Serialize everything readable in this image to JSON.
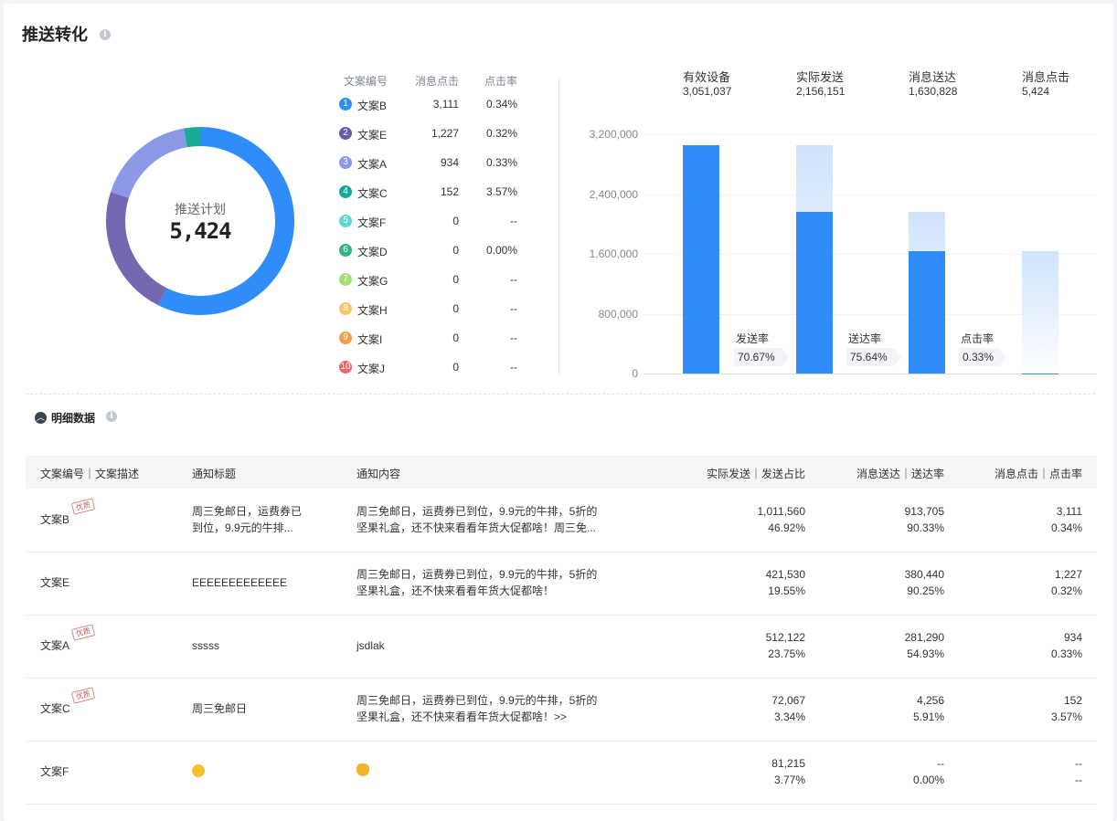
{
  "header": {
    "title": "推送转化",
    "info_icon": "info-icon"
  },
  "donut": {
    "center_label": "推送计划",
    "center_value": "5,424",
    "segments": [
      {
        "name": "文案B",
        "value": 3111,
        "color": "#2f8cf8"
      },
      {
        "name": "文案E",
        "value": 1227,
        "color": "#7568b3"
      },
      {
        "name": "文案A",
        "value": 934,
        "color": "#8a98e6"
      },
      {
        "name": "文案C",
        "value": 152,
        "color": "#1aaa9a"
      }
    ]
  },
  "legend": {
    "headers": {
      "id": "文案编号",
      "clicks": "消息点击",
      "rate": "点击率"
    },
    "rows": [
      {
        "num": "1",
        "name": "文案B",
        "clicks": "3,111",
        "rate": "0.34%",
        "color": "#2f8cf8"
      },
      {
        "num": "2",
        "name": "文案E",
        "clicks": "1,227",
        "rate": "0.32%",
        "color": "#6b5aa8"
      },
      {
        "num": "3",
        "name": "文案A",
        "clicks": "934",
        "rate": "0.33%",
        "color": "#8a98e6"
      },
      {
        "num": "4",
        "name": "文案C",
        "clicks": "152",
        "rate": "3.57%",
        "color": "#19a59a"
      },
      {
        "num": "5",
        "name": "文案F",
        "clicks": "0",
        "rate": "--",
        "color": "#5ed7d2"
      },
      {
        "num": "6",
        "name": "文案D",
        "clicks": "0",
        "rate": "0.00%",
        "color": "#34b28a"
      },
      {
        "num": "7",
        "name": "文案G",
        "clicks": "0",
        "rate": "--",
        "color": "#a6de7c"
      },
      {
        "num": "8",
        "name": "文案H",
        "clicks": "0",
        "rate": "--",
        "color": "#f7c66b"
      },
      {
        "num": "9",
        "name": "文案I",
        "clicks": "0",
        "rate": "--",
        "color": "#f0a04a"
      },
      {
        "num": "10",
        "name": "文案J",
        "clicks": "0",
        "rate": "--",
        "color": "#e86a6a"
      }
    ]
  },
  "kpis": [
    {
      "label": "有效设备",
      "value": "3,051,037"
    },
    {
      "label": "实际发送",
      "value": "2,156,151"
    },
    {
      "label": "消息送达",
      "value": "1,630,828"
    },
    {
      "label": "消息点击",
      "value": "5,424"
    }
  ],
  "chart_data": {
    "type": "bar",
    "categories": [
      "有效设备",
      "实际发送",
      "消息送达",
      "消息点击"
    ],
    "values": [
      3051037,
      2156151,
      1630828,
      5424
    ],
    "ghost_values": [
      null,
      3051037,
      2156151,
      1630828
    ],
    "ylim": [
      0,
      3200000
    ],
    "yticks": [
      "3,200,000",
      "2,400,000",
      "1,600,000",
      "800,000",
      "0"
    ],
    "ytick_values": [
      3200000,
      2400000,
      1600000,
      800000,
      0
    ],
    "rates": [
      {
        "label": "发送率",
        "value": "70.67%"
      },
      {
        "label": "送达率",
        "value": "75.64%"
      },
      {
        "label": "点击率",
        "value": "0.33%"
      }
    ],
    "bar_color": "#2f8cf8",
    "ghost_color": "#cfe3fb"
  },
  "detail": {
    "section_label": "明细数据",
    "columns": [
      "文案编号｜文案描述",
      "通知标题",
      "通知内容",
      "实际发送｜发送占比",
      "消息送达｜送达率",
      "消息点击｜点击率"
    ],
    "stamp_text": "优质",
    "rows": [
      {
        "id": "文案B",
        "quality": true,
        "title_1": "周三免邮日，运费券已",
        "title_2": "到位，9.9元的牛排...",
        "content_1": "周三免邮日，运费券已到位，9.9元的牛排，5折的",
        "content_2": "坚果礼盒，还不快来看看年货大促都啥！周三免...",
        "sent": "1,011,560",
        "sent_pct": "46.92%",
        "delivered": "913,705",
        "delivered_rate": "90.33%",
        "clicks": "3,111",
        "click_rate": "0.34%"
      },
      {
        "id": "文案E",
        "quality": false,
        "title_1": "EEEEEEEEEEEEE",
        "title_2": "",
        "content_1": "周三免邮日，运费券已到位，9.9元的牛排，5折的",
        "content_2": "坚果礼盒，还不快来看看年货大促都啥！",
        "sent": "421,530",
        "sent_pct": "19.55%",
        "delivered": "380,440",
        "delivered_rate": "90.25%",
        "clicks": "1,227",
        "click_rate": "0.32%"
      },
      {
        "id": "文案A",
        "quality": true,
        "title_1": "sssss",
        "title_2": "",
        "content_1": "jsdlak",
        "content_2": "",
        "sent": "512,122",
        "sent_pct": "23.75%",
        "delivered": "281,290",
        "delivered_rate": "54.93%",
        "clicks": "934",
        "click_rate": "0.33%"
      },
      {
        "id": "文案C",
        "quality": true,
        "title_1": "周三免邮日",
        "title_2": "",
        "content_1": "周三免邮日，运费券已到位，9.9元的牛排，5折的",
        "content_2": "坚果礼盒，还不快来看看年货大促都啥！>>",
        "sent": "72,067",
        "sent_pct": "3.34%",
        "delivered": "4,256",
        "delivered_rate": "5.91%",
        "clicks": "152",
        "click_rate": "3.57%"
      },
      {
        "id": "文案F",
        "quality": false,
        "title_emoji": "smiling-face-emoji",
        "content_emoji": "cat-face-emoji",
        "title_1": "",
        "title_2": "",
        "content_1": "",
        "content_2": "",
        "sent": "81,215",
        "sent_pct": "3.77%",
        "delivered": "--",
        "delivered_rate": "0.00%",
        "clicks": "--",
        "click_rate": "--"
      }
    ]
  }
}
